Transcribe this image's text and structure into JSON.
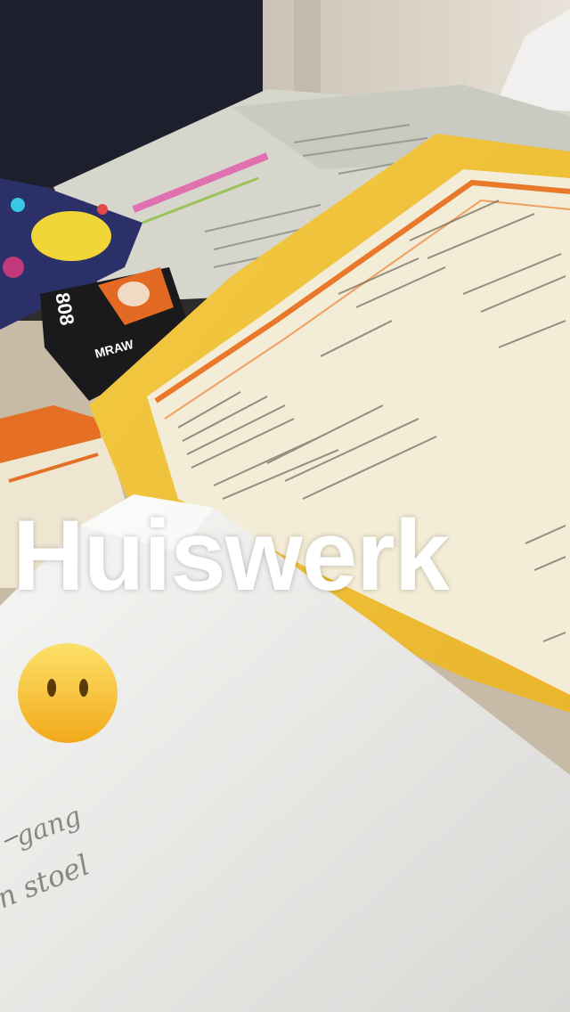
{
  "caption": {
    "text": "Huiswerk"
  },
  "emoji": {
    "icon": "face-without-mouth-emoji",
    "color": "#f7c21c"
  },
  "scene": {
    "description_icon": "homework-books-photo",
    "book_spine_text": "808",
    "book_spine_label": "MRAW",
    "handwriting_line_1": "gang",
    "handwriting_line_2": "n stoel"
  },
  "colors": {
    "folder_yellow": "#f0c438",
    "page_cream": "#f3ecd6",
    "accent_orange": "#e9782a",
    "notebook_white": "#f1f0ee"
  }
}
